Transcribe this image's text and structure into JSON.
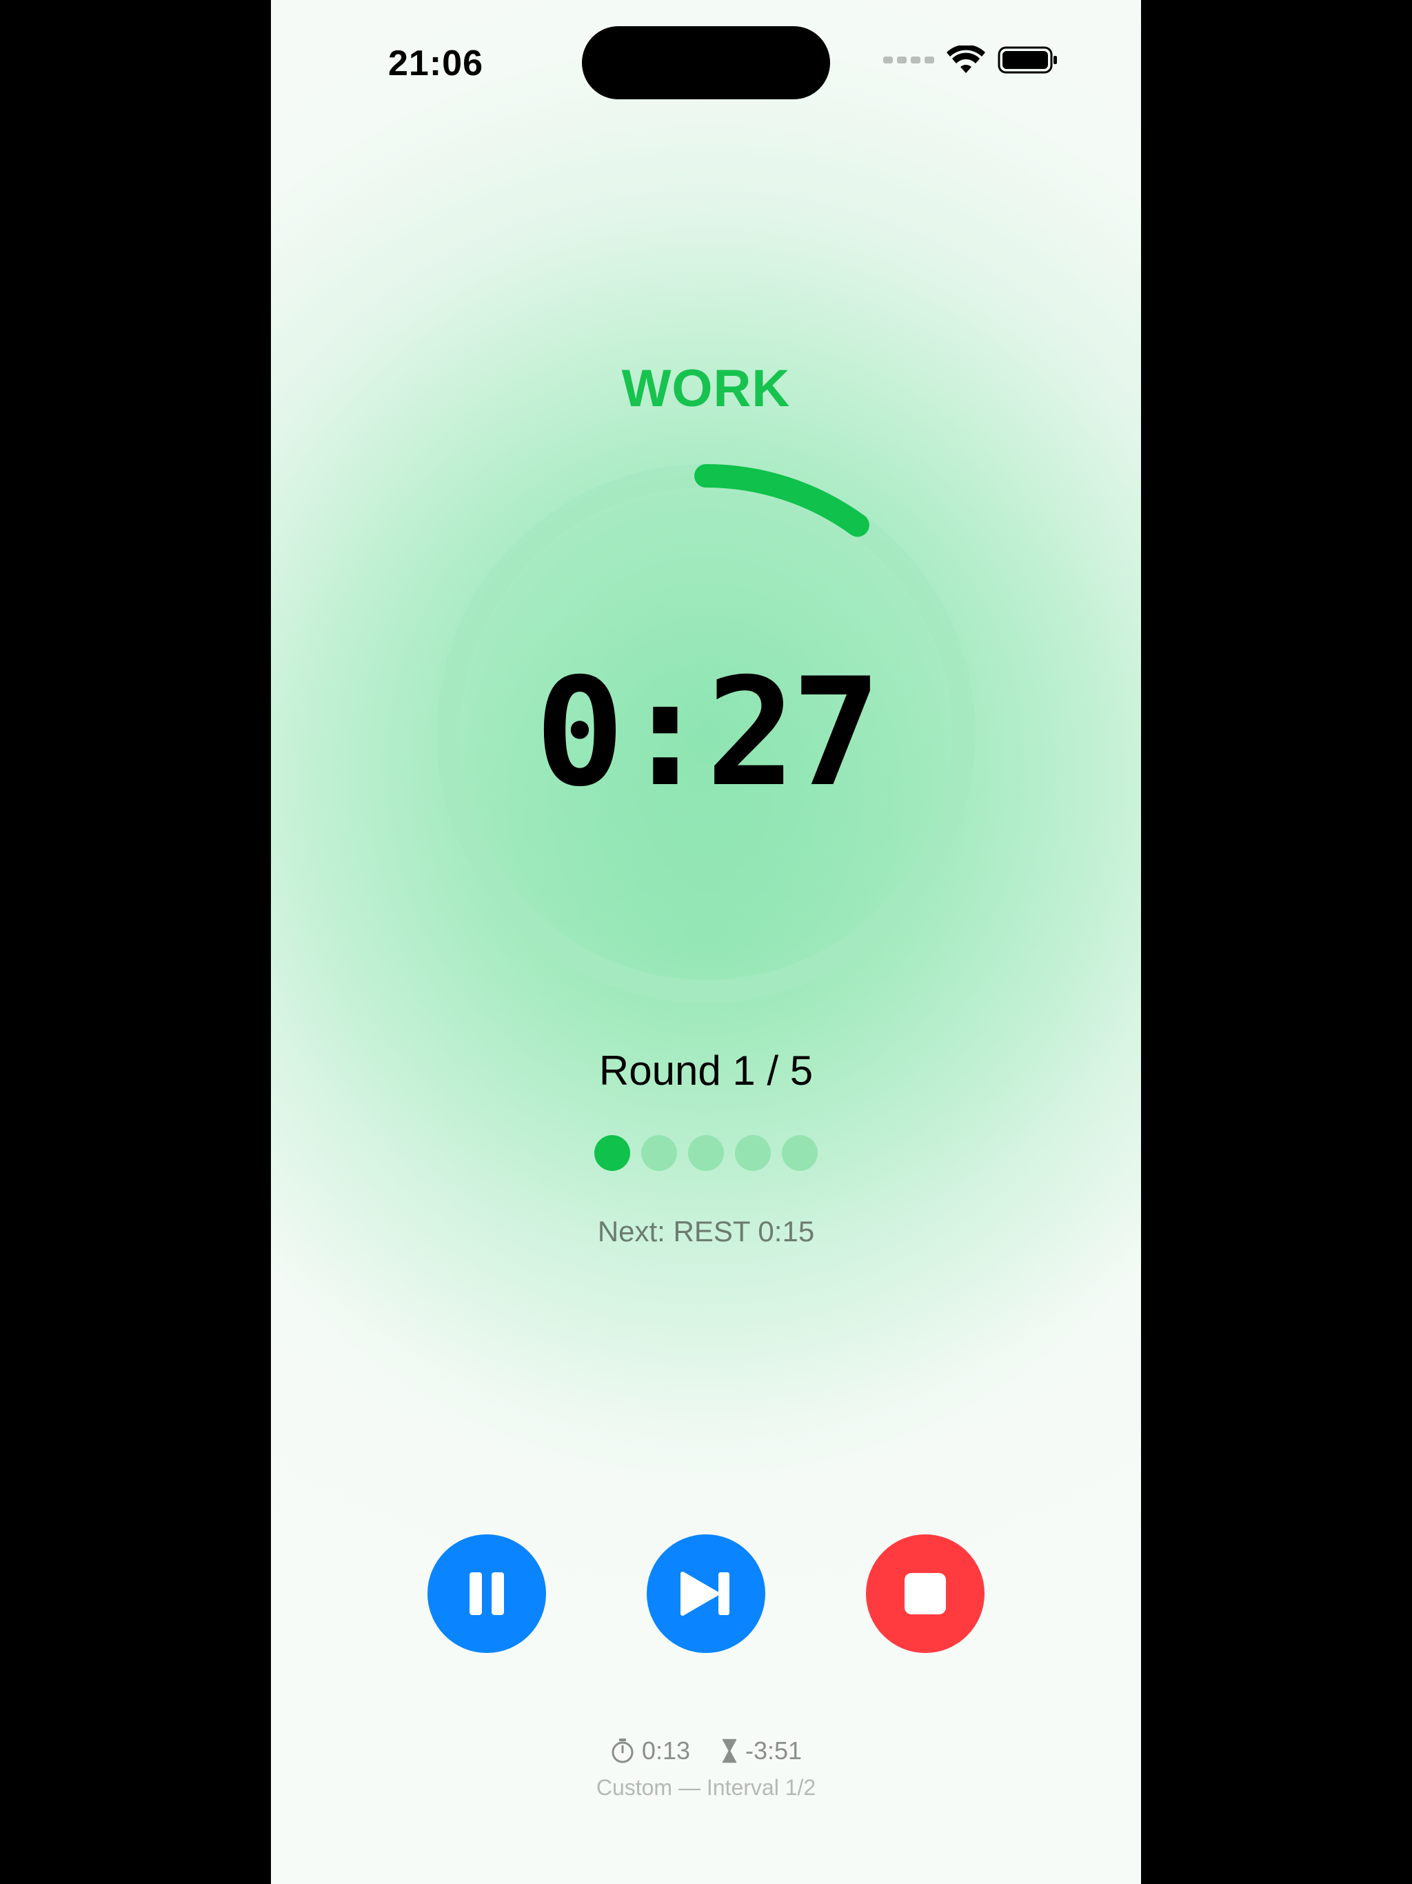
{
  "status_bar": {
    "time": "21:06"
  },
  "phase": {
    "label": "WORK",
    "color": "#17c24f"
  },
  "timer": {
    "display": "0:27",
    "progress": 0.1
  },
  "round": {
    "label": "Round 1 / 5",
    "current": 1,
    "total": 5
  },
  "next": {
    "label": "Next: REST 0:15"
  },
  "controls": {
    "pause_icon": "pause-icon",
    "skip_icon": "skip-forward-icon",
    "stop_icon": "stop-icon",
    "primary_color": "#0a84ff",
    "stop_color": "#ff3b40"
  },
  "footer": {
    "elapsed": "0:13",
    "remaining": "-3:51",
    "caption": "Custom — Interval 1/2"
  }
}
